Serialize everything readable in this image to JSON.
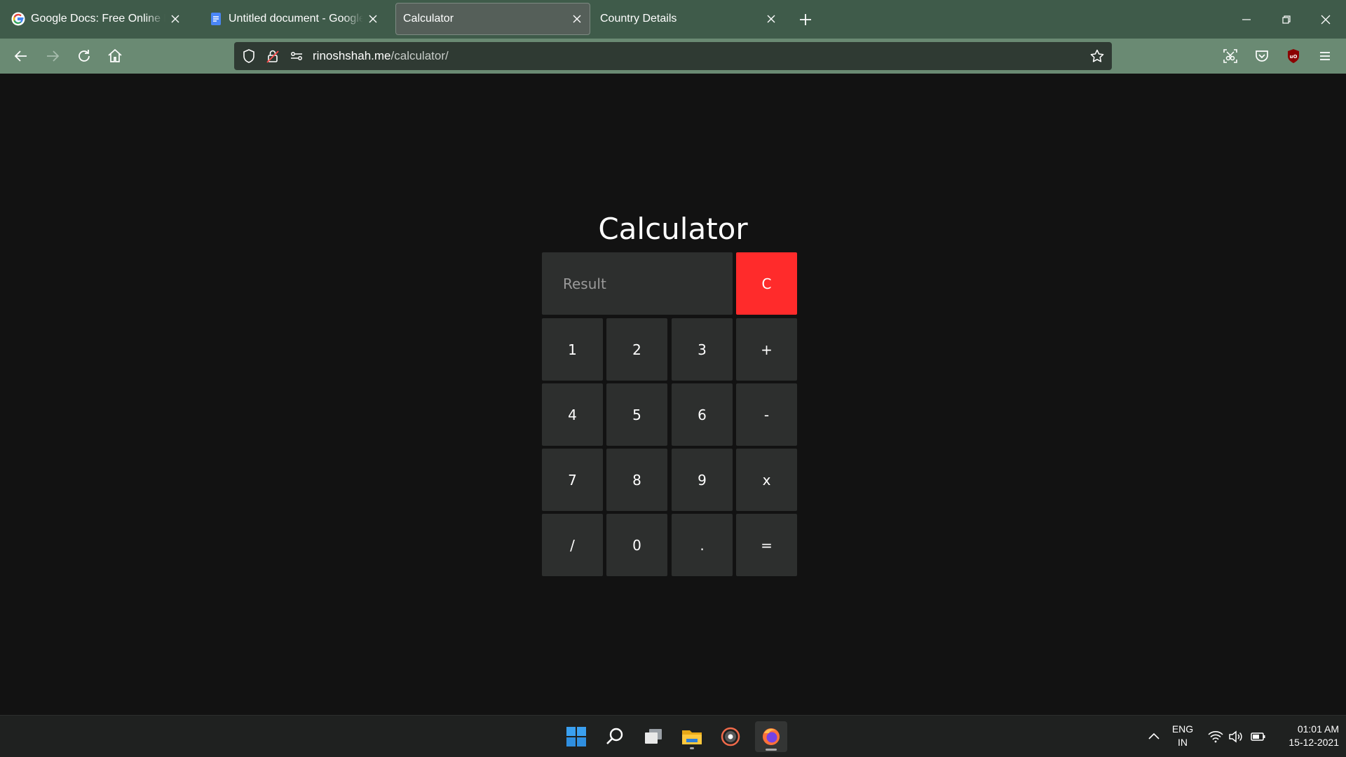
{
  "browser": {
    "tabs": [
      {
        "title": "Google Docs: Free Online Documents for Personal Use",
        "favicon": "google-g-icon",
        "active": false
      },
      {
        "title": "Untitled document - Google Docs",
        "favicon": "google-docs-icon",
        "active": false
      },
      {
        "title": "Calculator",
        "favicon": "",
        "active": true
      },
      {
        "title": "Country Details",
        "favicon": "",
        "active": false
      }
    ],
    "url": {
      "domain": "rinoshshah.me",
      "path": "/calculator/"
    },
    "colors": {
      "tabstrip": "#3f5b4a",
      "navbar": "#6a8a73",
      "urlbar": "#2f3a33"
    }
  },
  "page": {
    "title": "Calculator",
    "result_placeholder": "Result",
    "result_value": "",
    "clear_label": "C",
    "keys": [
      "1",
      "2",
      "3",
      "+",
      "4",
      "5",
      "6",
      "-",
      "7",
      "8",
      "9",
      "x",
      "/",
      "0",
      ".",
      "="
    ],
    "colors": {
      "background": "#121212",
      "key": "#2d2f2e",
      "clear": "#ff2b2b",
      "text": "#ffffff"
    }
  },
  "taskbar": {
    "apps": [
      "start-icon",
      "search-icon",
      "task-view-icon",
      "file-explorer-icon",
      "media-app-icon",
      "firefox-icon"
    ],
    "language": {
      "line1": "ENG",
      "line2": "IN"
    },
    "time": "01:01 AM",
    "date": "15-12-2021"
  }
}
